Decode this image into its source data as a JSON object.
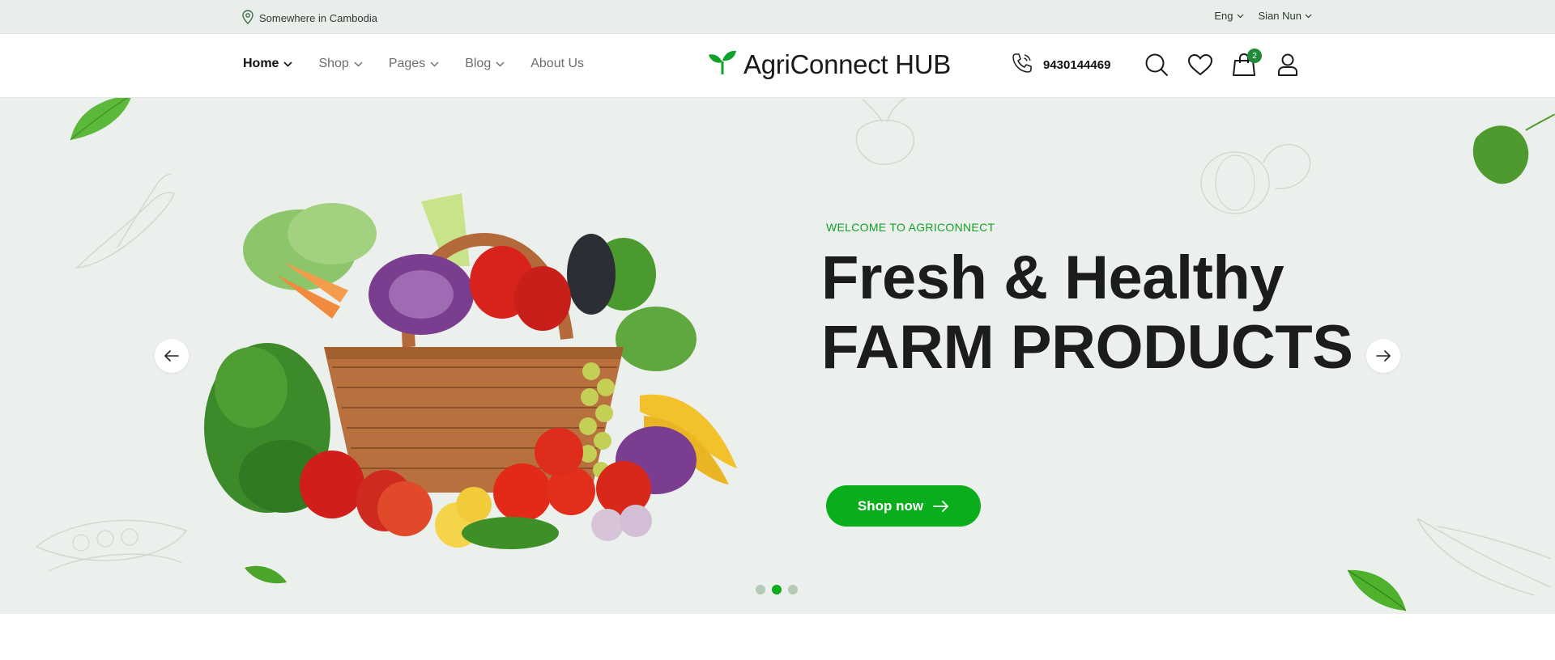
{
  "topbar": {
    "location": "Somewhere in Cambodia",
    "language": "Eng",
    "user": "Sian Nun"
  },
  "nav": {
    "items": [
      {
        "label": "Home",
        "active": true,
        "dropdown": true
      },
      {
        "label": "Shop",
        "active": false,
        "dropdown": true
      },
      {
        "label": "Pages",
        "active": false,
        "dropdown": true
      },
      {
        "label": "Blog",
        "active": false,
        "dropdown": true
      },
      {
        "label": "About Us",
        "active": false,
        "dropdown": false
      }
    ]
  },
  "brand": {
    "name": "AgriConnect HUB",
    "logo_icon": "sprout-icon"
  },
  "contact": {
    "phone": "9430144469"
  },
  "header_icons": {
    "search": "search-icon",
    "wishlist": "heart-icon",
    "cart": "shopping-bag-icon",
    "cart_count": "2",
    "account": "user-icon"
  },
  "hero": {
    "eyebrow": "WELCOME TO AGRICONNECT",
    "title_line1": "Fresh & Healthy",
    "title_line2": "FARM PRODUCTS",
    "cta_label": "Shop now",
    "slides_total": 3,
    "active_slide": 2
  },
  "colors": {
    "accent": "#0aae1c",
    "hero_bg": "#ecf0ec",
    "topbar_bg": "#e9eeea",
    "text_dark": "#1b1c1b"
  }
}
